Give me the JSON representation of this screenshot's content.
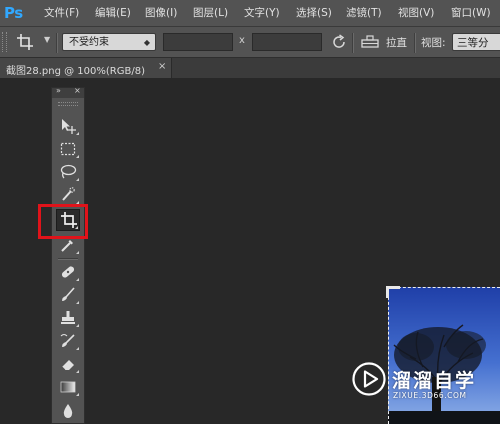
{
  "app": {
    "logo_text": "Ps",
    "accent_color": "#31a8ff",
    "menu": [
      {
        "label": "文件(F)"
      },
      {
        "label": "编辑(E)"
      },
      {
        "label": "图像(I)"
      },
      {
        "label": "图层(L)"
      },
      {
        "label": "文字(Y)"
      },
      {
        "label": "选择(S)"
      },
      {
        "label": "滤镜(T)"
      },
      {
        "label": "视图(V)"
      },
      {
        "label": "窗口(W)"
      }
    ]
  },
  "options_bar": {
    "tool_icon": "crop-icon",
    "ratio_preset": "不受约束",
    "width_value": "",
    "height_value": "",
    "x_separator": "x",
    "swap_icon": "rotate-arrows-icon",
    "straighten_icon": "level-icon",
    "straighten_label": "拉直",
    "view_label": "视图:",
    "view_value": "三等分"
  },
  "document": {
    "tab_label": "截图28.png @ 100%(RGB/8)",
    "close_glyph": "×"
  },
  "toolbox": {
    "header_collapse": "»",
    "header_close": "×",
    "tools": [
      {
        "name": "move-tool",
        "icon": "move-icon",
        "selected": false
      },
      {
        "name": "marquee-tool",
        "icon": "rect-marquee-icon",
        "selected": false
      },
      {
        "name": "lasso-tool",
        "icon": "lasso-icon",
        "selected": false
      },
      {
        "name": "quick-select-tool",
        "icon": "quick-select-icon",
        "selected": false
      },
      {
        "name": "crop-tool",
        "icon": "crop-icon",
        "selected": true
      },
      {
        "name": "eyedropper-tool",
        "icon": "eyedropper-icon",
        "selected": false
      },
      {
        "name": "healing-tool",
        "icon": "bandage-icon",
        "selected": false
      },
      {
        "name": "brush-tool",
        "icon": "brush-icon",
        "selected": false
      },
      {
        "name": "stamp-tool",
        "icon": "stamp-icon",
        "selected": false
      },
      {
        "name": "history-brush-tool",
        "icon": "history-brush-icon",
        "selected": false
      },
      {
        "name": "eraser-tool",
        "icon": "eraser-icon",
        "selected": false
      },
      {
        "name": "gradient-tool",
        "icon": "gradient-icon",
        "selected": false
      },
      {
        "name": "blur-tool",
        "icon": "drop-icon",
        "selected": false
      }
    ],
    "highlight_color": "#e0131a"
  },
  "watermark": {
    "title": "溜溜自学",
    "subtitle": "ZIXUE.3D66.COM"
  }
}
